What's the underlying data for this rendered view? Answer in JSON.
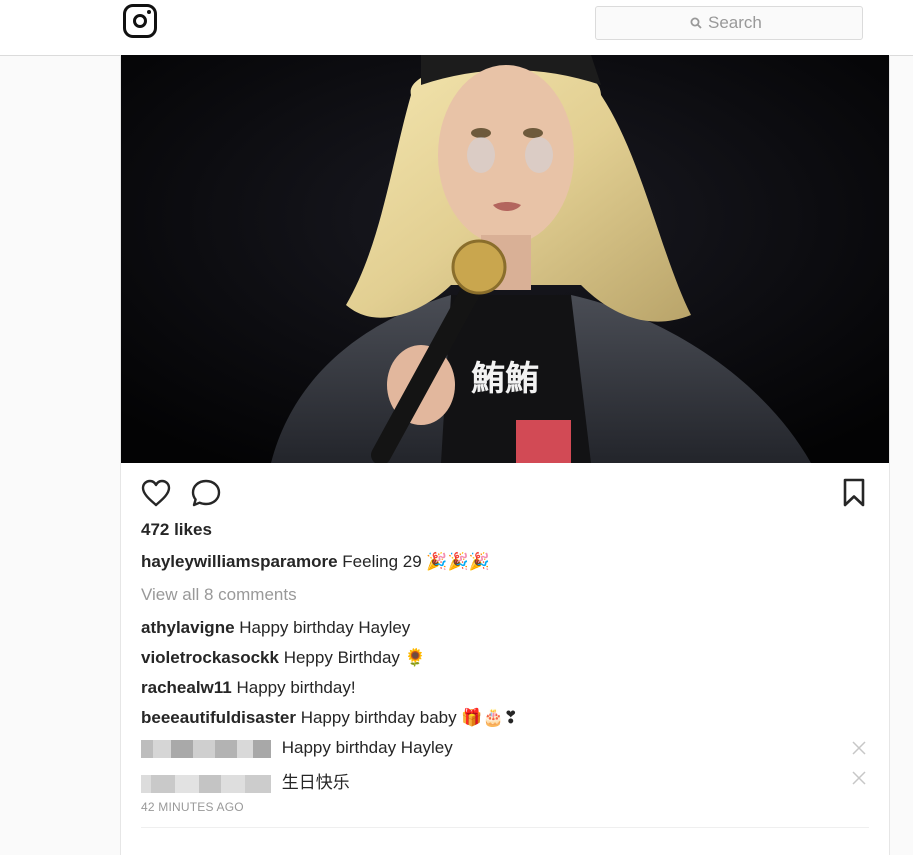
{
  "header": {
    "logo_icon": "instagram-logo-icon",
    "search_placeholder": "Search"
  },
  "post": {
    "image_alt": "",
    "likes": "472 likes",
    "caption": {
      "user": "hayleywilliamsparamore",
      "text": "Feeling 29 🎉🎉🎉"
    },
    "view_all": "View all 8 comments",
    "comments": [
      {
        "user": "athylavigne",
        "text": "Happy birthday Hayley"
      },
      {
        "user": "violetrockasockk",
        "text": "Heppy Birthday 🌻"
      },
      {
        "user": "rachealw11",
        "text": "Happy birthday!"
      },
      {
        "user": "beeeautifuldisaster",
        "text": "Happy birthday baby 🎁🎂❣"
      },
      {
        "user": "",
        "text": "Happy birthday Hayley"
      },
      {
        "user": "",
        "text": "生日快乐"
      }
    ],
    "timestamp": "42 MINUTES AGO"
  },
  "colors": {
    "text": "#262626",
    "muted": "#999999",
    "border": "#dbdbdb"
  }
}
